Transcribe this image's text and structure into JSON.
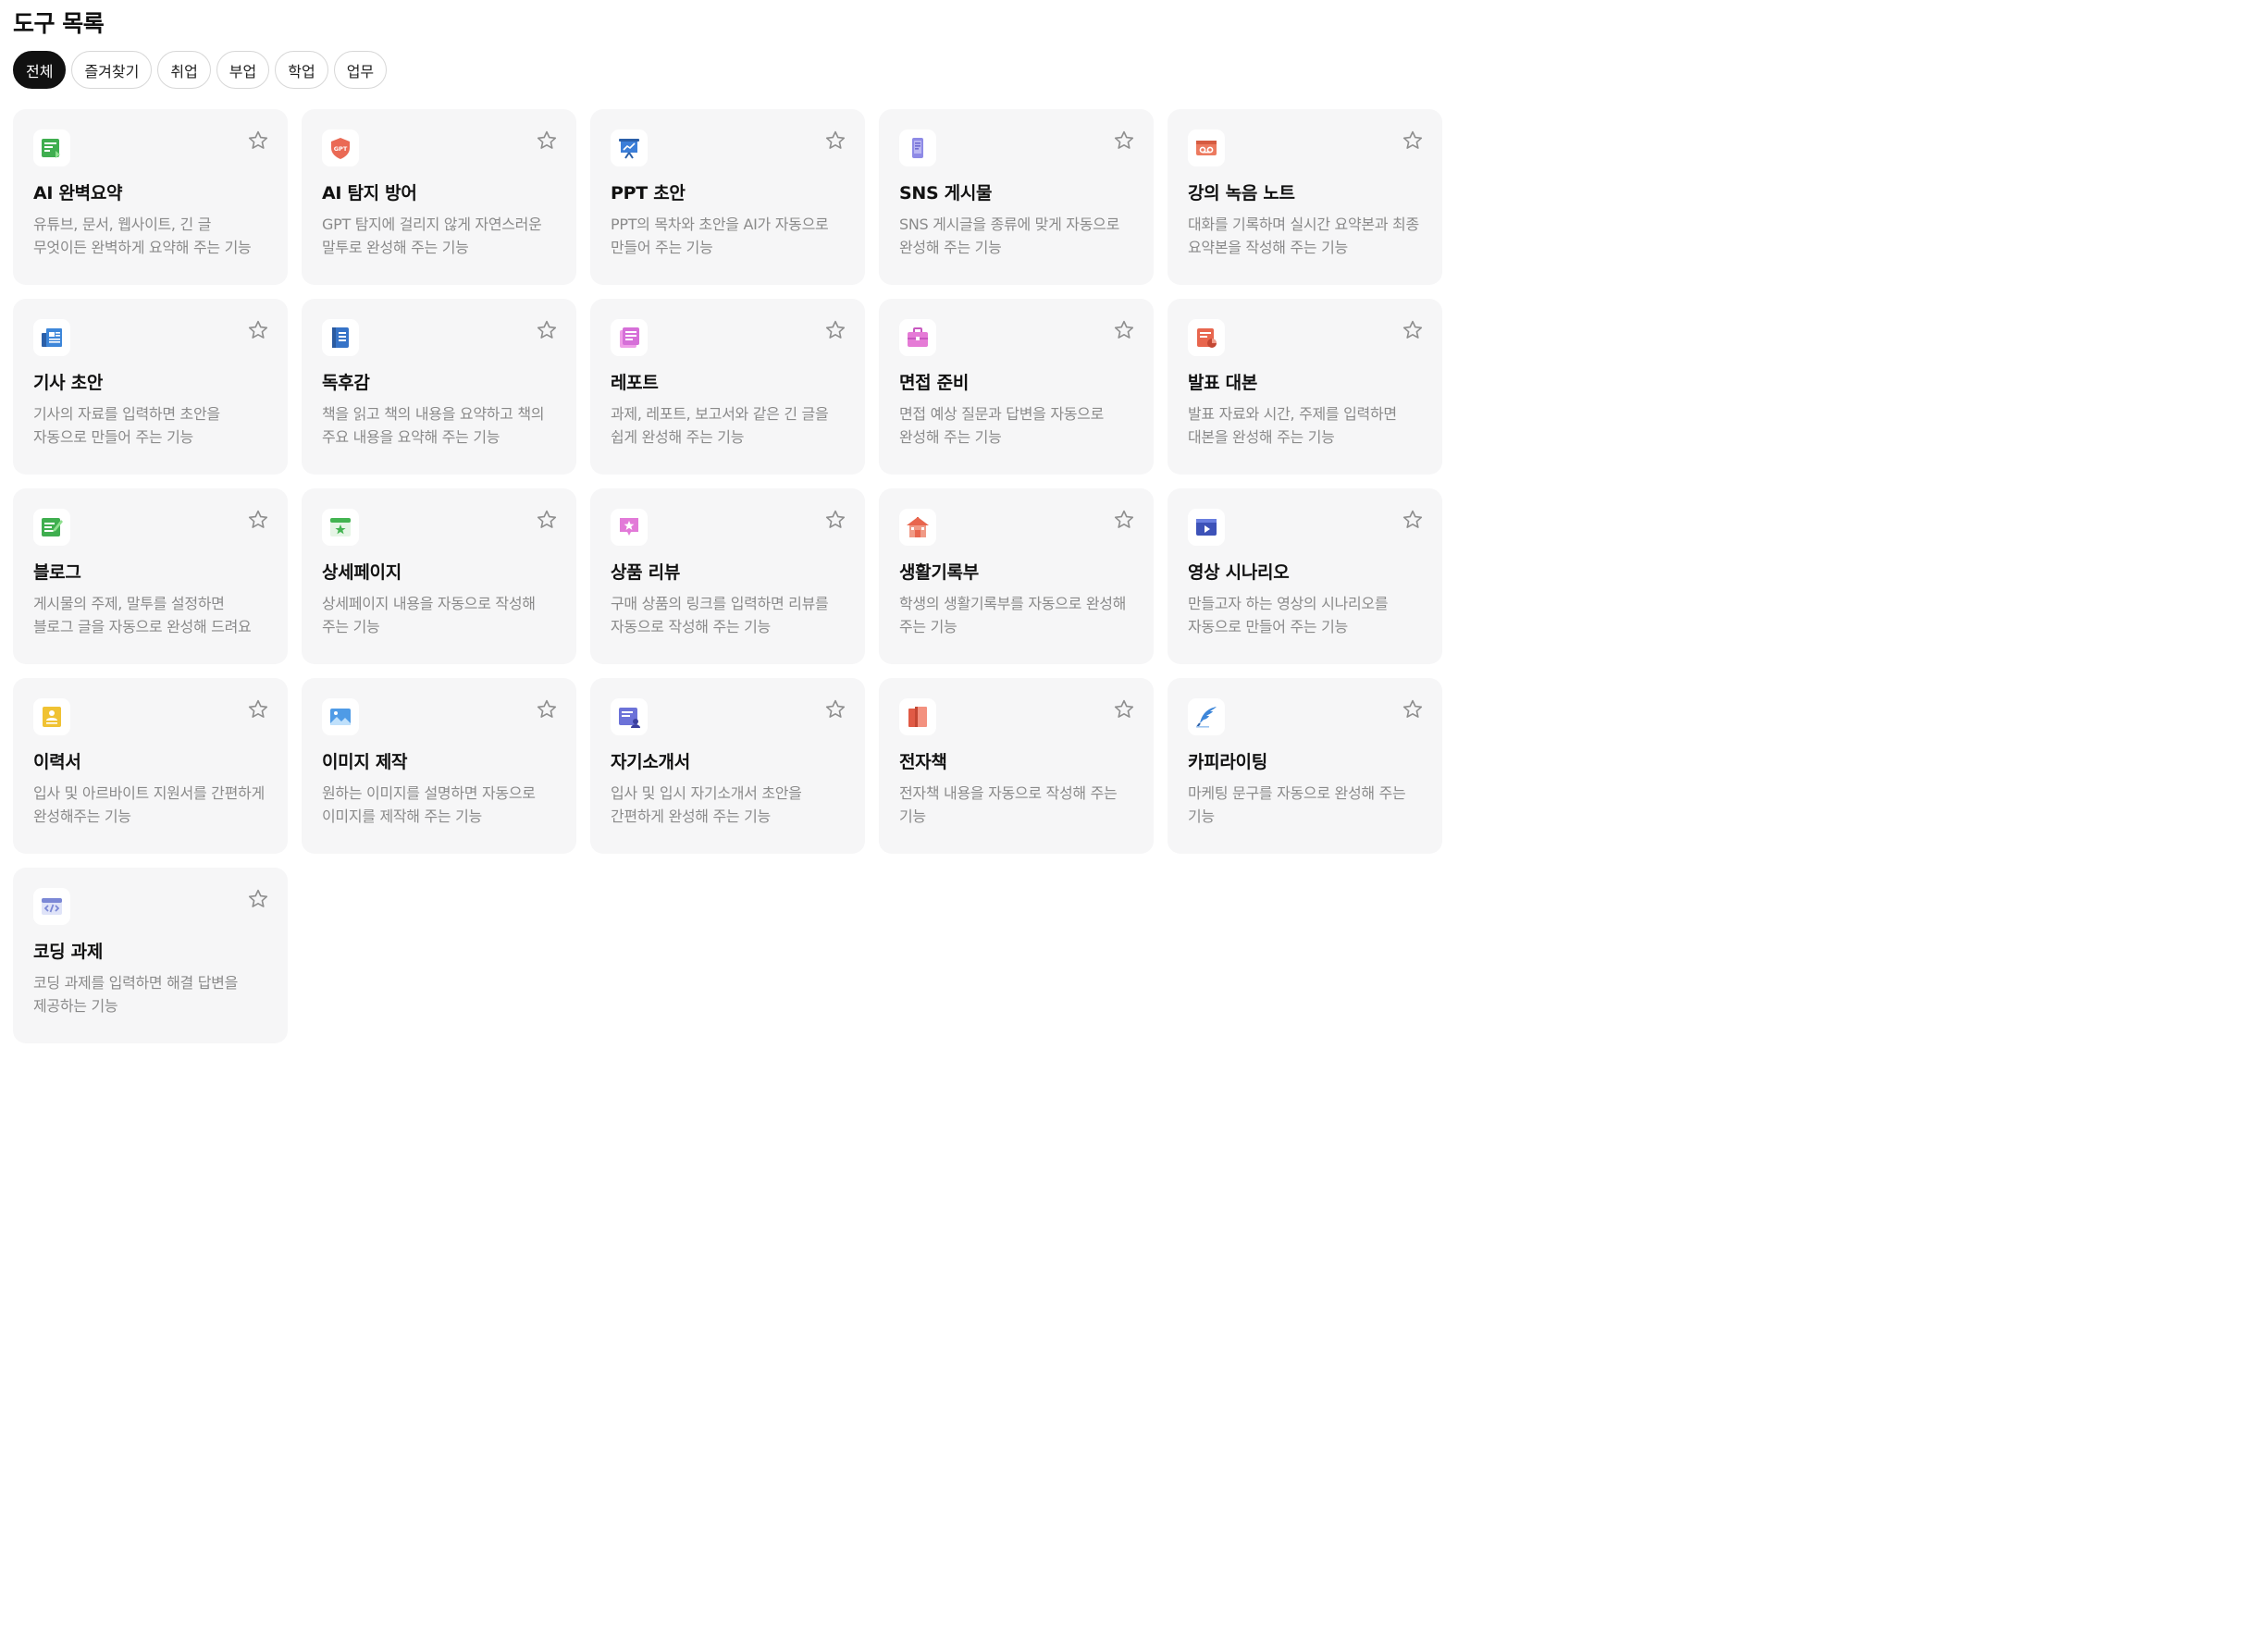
{
  "header": {
    "title": "도구 목록"
  },
  "filters": [
    {
      "label": "전체",
      "active": true
    },
    {
      "label": "즐겨찾기",
      "active": false
    },
    {
      "label": "취업",
      "active": false
    },
    {
      "label": "부업",
      "active": false
    },
    {
      "label": "학업",
      "active": false
    },
    {
      "label": "업무",
      "active": false
    }
  ],
  "tools": [
    {
      "title": "AI 완벽요약",
      "desc": "유튜브, 문서, 웹사이트, 긴 글 무엇이든 완벽하게 요약해 주는 기능",
      "icon": "summary-icon",
      "color": "#3fae4f"
    },
    {
      "title": "AI 탐지 방어",
      "desc": "GPT 탐지에 걸리지 않게 자연스러운 말투로 완성해 주는 기능",
      "icon": "gpt-shield-icon",
      "color": "#ea6a55",
      "icon_text": "GPT"
    },
    {
      "title": "PPT 초안",
      "desc": "PPT의 목차와 초안을 AI가 자동으로 만들어 주는 기능",
      "icon": "presentation-icon",
      "color": "#3b7ed8"
    },
    {
      "title": "SNS 게시물",
      "desc": "SNS 게시글을 종류에 맞게 자동으로 완성해 주는 기능",
      "icon": "phone-icon",
      "color": "#8e8ae6"
    },
    {
      "title": "강의 녹음 노트",
      "desc": "대화를 기록하며 실시간 요약본과 최종 요약본을 작성해 주는 기능",
      "icon": "recorder-icon",
      "color": "#ec7a5f"
    },
    {
      "title": "기사 초안",
      "desc": "기사의 자료를 입력하면 초안을 자동으로 만들어 주는 기능",
      "icon": "newspaper-icon",
      "color": "#3d86d9"
    },
    {
      "title": "독후감",
      "desc": "책을 읽고 책의 내용을 요약하고 책의 주요 내용을 요약해 주는 기능",
      "icon": "book-icon",
      "color": "#3673c7"
    },
    {
      "title": "레포트",
      "desc": "과제, 레포트, 보고서와 같은 긴 글을 쉽게 완성해 주는 기능",
      "icon": "report-icon",
      "color": "#d66fd8"
    },
    {
      "title": "면접 준비",
      "desc": "면접 예상 질문과 답변을 자동으로 완성해 주는 기능",
      "icon": "briefcase-icon",
      "color": "#e57bd6"
    },
    {
      "title": "발표 대본",
      "desc": "발표 자료와 시간, 주제를 입력하면 대본을 완성해 주는 기능",
      "icon": "script-icon",
      "color": "#e8664e"
    },
    {
      "title": "블로그",
      "desc": "게시물의 주제, 말투를 설정하면 블로그 글을 자동으로 완성해 드려요",
      "icon": "blog-icon",
      "color": "#3fae4f"
    },
    {
      "title": "상세페이지",
      "desc": "상세페이지 내용을 자동으로 작성해 주는 기능",
      "icon": "detail-page-icon",
      "color": "#43b451"
    },
    {
      "title": "상품 리뷰",
      "desc": "구매 상품의 링크를 입력하면 리뷰를 자동으로 작성해 주는 기능",
      "icon": "review-icon",
      "color": "#e27ad8"
    },
    {
      "title": "생활기록부",
      "desc": "학생의 생활기록부를 자동으로 완성해 주는 기능",
      "icon": "school-icon",
      "color": "#e8664e"
    },
    {
      "title": "영상 시나리오",
      "desc": "만들고자 하는 영상의 시나리오를 자동으로 만들어 주는 기능",
      "icon": "video-icon",
      "color": "#3d52b8"
    },
    {
      "title": "이력서",
      "desc": "입사 및 아르바이트 지원서를 간편하게 완성해주는 기능",
      "icon": "resume-icon",
      "color": "#f0c233"
    },
    {
      "title": "이미지 제작",
      "desc": "원하는 이미지를 설명하면 자동으로 이미지를 제작해 주는 기능",
      "icon": "image-icon",
      "color": "#4f9be6"
    },
    {
      "title": "자기소개서",
      "desc": "입사 및 입시 자기소개서 초안을 간편하게 완성해 주는 기능",
      "icon": "self-intro-icon",
      "color": "#6c72d8"
    },
    {
      "title": "전자책",
      "desc": "전자책 내용을 자동으로 작성해 주는 기능",
      "icon": "ebook-icon",
      "color": "#e05a45"
    },
    {
      "title": "카피라이팅",
      "desc": "마케팅 문구를 자동으로 완성해 주는 기능",
      "icon": "quill-icon",
      "color": "#3d86d9"
    },
    {
      "title": "코딩 과제",
      "desc": "코딩 과제를 입력하면 해결 답변을 제공하는 기능",
      "icon": "code-icon",
      "color": "#7b88d6"
    }
  ]
}
